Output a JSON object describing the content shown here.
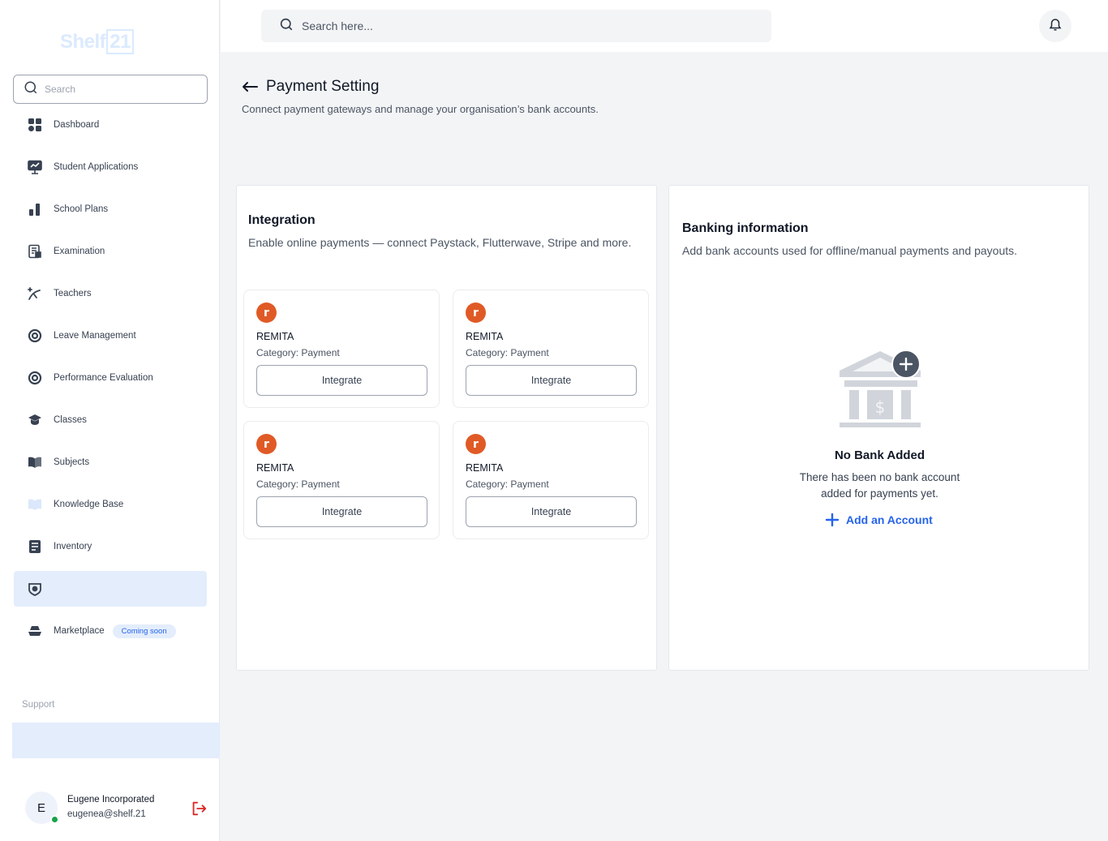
{
  "sidebar": {
    "logo": {
      "text": "Shelf",
      "num": "21"
    },
    "search_placeholder": "Search",
    "items": [
      {
        "label": "Dashboard",
        "icon": "grid-icon"
      },
      {
        "label": "Student Applications",
        "icon": "chart-board-icon"
      },
      {
        "label": "School Plans",
        "icon": "bar-chart-icon"
      },
      {
        "label": "Examination",
        "icon": "exam-icon"
      },
      {
        "label": "Teachers",
        "icon": "teacher-icon"
      },
      {
        "label": "Leave Management",
        "icon": "lifebuoy-icon"
      },
      {
        "label": "Performance Evaluation",
        "icon": "lifebuoy-icon"
      },
      {
        "label": "Classes",
        "icon": "graduation-cap-icon"
      },
      {
        "label": "Subjects",
        "icon": "book-open-icon"
      },
      {
        "label": "Knowledge Base",
        "icon": "book-icon"
      },
      {
        "label": "Inventory",
        "icon": "list-icon"
      },
      {
        "label": "",
        "icon": "settings-shield-icon",
        "active": true
      },
      {
        "label": "Marketplace",
        "icon": "boat-icon",
        "badge": "Coming soon"
      }
    ],
    "support_label": "Support",
    "user": {
      "initial": "E",
      "name": "Eugene Incorporated",
      "email": "eugenea@shelf.21"
    }
  },
  "topbar": {
    "search_placeholder": "Search here..."
  },
  "header": {
    "title": "Payment Setting",
    "subtitle": "Connect payment gateways and manage your organisation’s bank accounts."
  },
  "integration": {
    "title": "Integration",
    "subtitle": "Enable online payments — connect Paystack, Flutterwave, Stripe and more.",
    "cards": [
      {
        "logo": "r",
        "name": "REMITA",
        "category": "Category: Payment",
        "button": "Integrate"
      },
      {
        "logo": "r",
        "name": "REMITA",
        "category": "Category: Payment",
        "button": "Integrate"
      },
      {
        "logo": "r",
        "name": "REMITA",
        "category": "Category: Payment",
        "button": "Integrate"
      },
      {
        "logo": "r",
        "name": "REMITA",
        "category": "Category: Payment",
        "button": "Integrate"
      }
    ]
  },
  "banking": {
    "title": "Banking information",
    "subtitle": "Add bank accounts used for offline/manual payments and payouts.",
    "empty_title": "No Bank Added",
    "empty_line1": "There has been no bank account",
    "empty_line2": "added for payments yet.",
    "add_label": "Add an Account"
  },
  "colors": {
    "accent": "#2563eb",
    "active_bg": "#e3edfc",
    "remita": "#e05a26",
    "online": "#16a34a",
    "logout": "#dc2626"
  }
}
